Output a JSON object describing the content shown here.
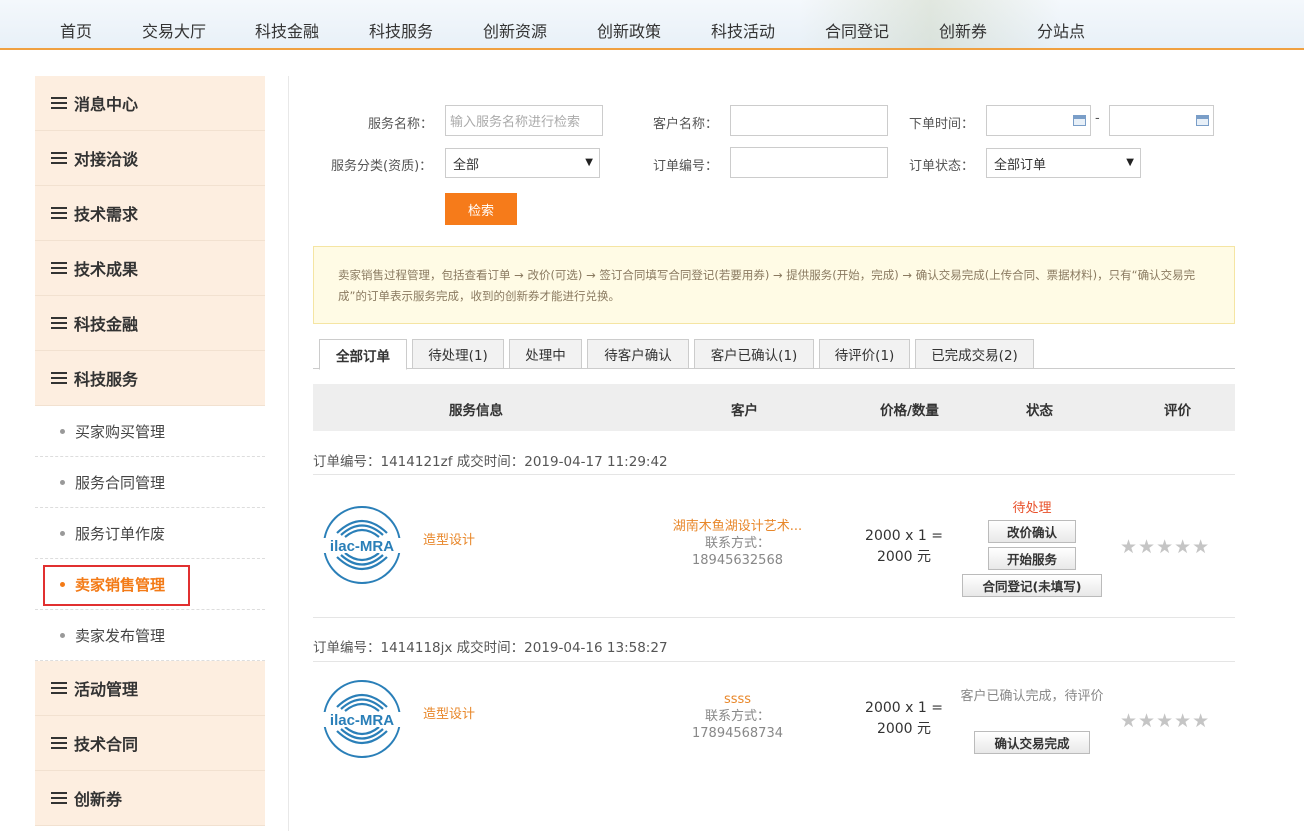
{
  "nav": [
    "首页",
    "交易大厅",
    "科技金融",
    "科技服务",
    "创新资源",
    "创新政策",
    "科技活动",
    "合同登记",
    "创新券",
    "分站点"
  ],
  "sidebar": {
    "top_items": [
      "消息中心",
      "对接洽谈",
      "技术需求",
      "技术成果",
      "科技金融",
      "科技服务"
    ],
    "sub_items": [
      "买家购买管理",
      "服务合同管理",
      "服务订单作废",
      "卖家销售管理",
      "卖家发布管理"
    ],
    "active_sub": "卖家销售管理",
    "bottom_items": [
      "活动管理",
      "技术合同",
      "创新券"
    ]
  },
  "filters": {
    "service_name_label": "服务名称：",
    "service_name_placeholder": "输入服务名称进行检索",
    "customer_label": "客户名称：",
    "order_time_label": "下单时间：",
    "date_sep": "-",
    "category_label": "服务分类(资质)：",
    "category_value": "全部",
    "order_no_label": "订单编号：",
    "order_status_label": "订单状态：",
    "order_status_value": "全部订单",
    "search_button": "检索"
  },
  "notice": "卖家销售过程管理，包括查看订单 → 改价(可选) → 签订合同填写合同登记(若要用券) → 提供服务(开始，完成) → 确认交易完成(上传合同、票据材料)，只有“确认交易完成”的订单表示服务完成，收到的创新券才能进行兑换。",
  "tabs": [
    "全部订单",
    "待处理(1)",
    "处理中",
    "待客户确认",
    "客户已确认(1)",
    "待评价(1)",
    "已完成交易(2)"
  ],
  "table_headers": [
    "服务信息",
    "客户",
    "价格/数量",
    "状态",
    "评价"
  ],
  "orders": [
    {
      "meta": "订单编号：1414121zf    成交时间：2019-04-17 11:29:42",
      "logo_text": "ilac-MRA",
      "service": "造型设计",
      "customer": "湖南木鱼湖设计艺术...",
      "contact_label": "联系方式：",
      "contact": "18945632568",
      "price_line1": "2000 x 1 =",
      "price_line2": "2000 元",
      "status": "待处理",
      "actions": [
        "改价确认",
        "开始服务",
        "合同登记(未填写)"
      ],
      "rating_stars": "★★★★★"
    },
    {
      "meta": "订单编号：1414118jx    成交时间：2019-04-16 13:58:27",
      "logo_text": "ilac-MRA",
      "service": "造型设计",
      "customer": "ssss",
      "contact_label": "联系方式：",
      "contact": "17894568734",
      "price_line1": "2000 x 1 =",
      "price_line2": "2000 元",
      "status": "客户已确认完成，待评价",
      "actions": [
        "确认交易完成"
      ],
      "rating_stars": "★★★★★"
    }
  ],
  "colors": {
    "accent": "#f67b1a",
    "status_pending": "#e8502a",
    "sidebar_bg": "#fdeee0",
    "active_box": "#e13030"
  }
}
